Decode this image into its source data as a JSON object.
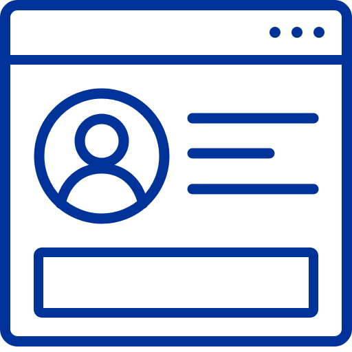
{
  "icon": {
    "semantic": "browser-window-user-profile-icon",
    "color": "#003399",
    "background": "#ffffff"
  },
  "window": {
    "controls": [
      "window-dot",
      "window-dot",
      "window-dot"
    ]
  },
  "profile": {
    "avatar_icon": "user-avatar-icon",
    "text_lines": 3
  },
  "input": {
    "value": "",
    "placeholder": ""
  }
}
